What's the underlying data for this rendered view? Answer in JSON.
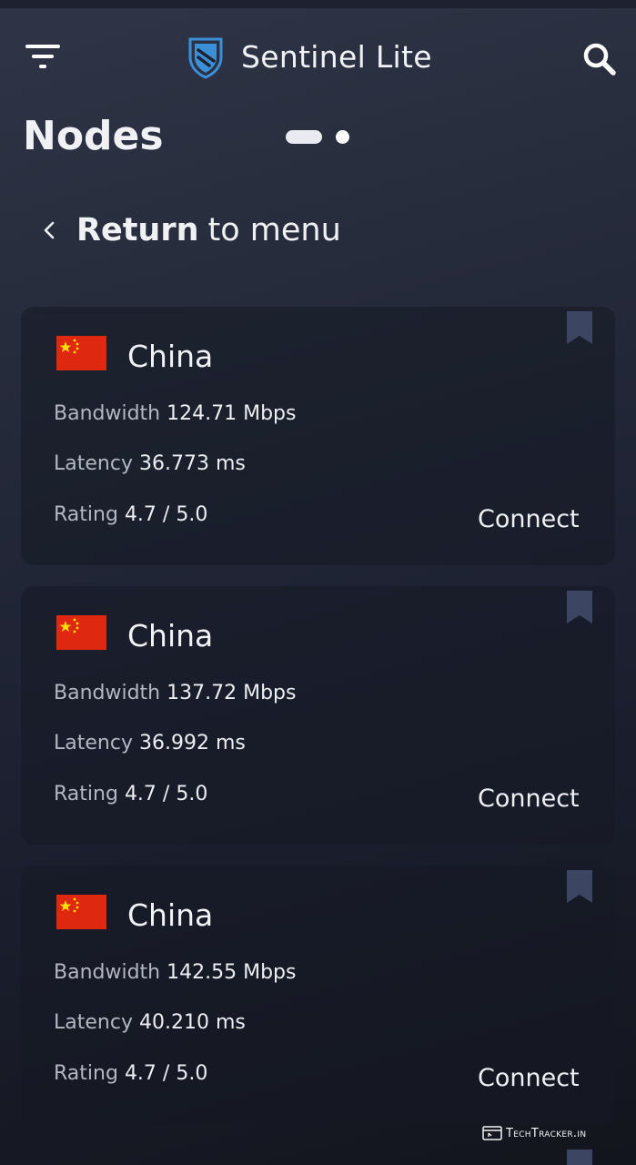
{
  "app": {
    "title": "Sentinel Lite"
  },
  "page": {
    "title": "Nodes",
    "pager": {
      "total": 2,
      "active": 1
    },
    "return_link": {
      "bold": "Return",
      "rest": "to menu"
    }
  },
  "nodes": [
    {
      "country": "China",
      "flag": "china-flag",
      "bandwidth_label": "Bandwidth",
      "bandwidth": "124.71 Mbps",
      "latency_label": "Latency",
      "latency": "36.773 ms",
      "rating_label": "Rating",
      "rating": "4.7 / 5.0",
      "connect_label": "Connect"
    },
    {
      "country": "China",
      "flag": "china-flag",
      "bandwidth_label": "Bandwidth",
      "bandwidth": "137.72 Mbps",
      "latency_label": "Latency",
      "latency": "36.992 ms",
      "rating_label": "Rating",
      "rating": "4.7 / 5.0",
      "connect_label": "Connect"
    },
    {
      "country": "China",
      "flag": "china-flag",
      "bandwidth_label": "Bandwidth",
      "bandwidth": "142.55 Mbps",
      "latency_label": "Latency",
      "latency": "40.210 ms",
      "rating_label": "Rating",
      "rating": "4.7 / 5.0",
      "connect_label": "Connect"
    }
  ],
  "watermark": {
    "text": "TechTracker.in"
  },
  "icons": {
    "menu": "filter-menu-icon",
    "logo": "shield-logo-icon",
    "search": "search-icon",
    "back": "chevron-left-icon",
    "bookmark": "bookmark-icon"
  },
  "colors": {
    "background_top": "#2f3547",
    "background_bottom": "#13151d",
    "logo_blue": "#3b8fd6",
    "bookmark": "#3c4663",
    "flag_red": "#de2910",
    "flag_yellow": "#ffde00"
  }
}
